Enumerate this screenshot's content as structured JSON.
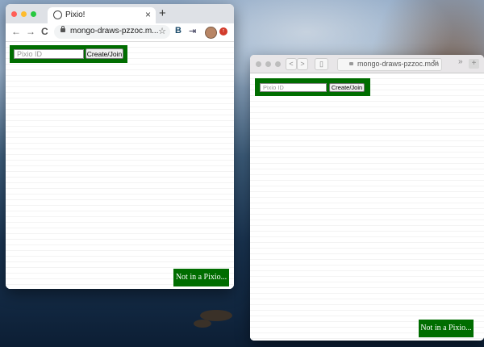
{
  "chrome": {
    "tab_title": "Pixio!",
    "tab_close": "×",
    "new_tab": "+",
    "back": "←",
    "forward": "→",
    "reload": "C",
    "url": "mongo-draws-pzzoc.m...",
    "bookmark": "☆",
    "ext1": "B",
    "ext2": "⇥",
    "update_badge": "↑"
  },
  "safari": {
    "back": "<",
    "forward": ">",
    "sidebar": "▯",
    "url": "mongo-draws-pzzoc.mon",
    "reload": "↻",
    "more": "»",
    "new_tab": "+"
  },
  "app": {
    "pixio_id_placeholder": "Pixio ID",
    "create_join_label": "Create/Join",
    "status_label": "Not in a Pixio..."
  },
  "colors": {
    "accent_green": "#006d00",
    "traffic_red": "#ff5f57",
    "traffic_yellow": "#febc2e",
    "traffic_green": "#28c840"
  }
}
